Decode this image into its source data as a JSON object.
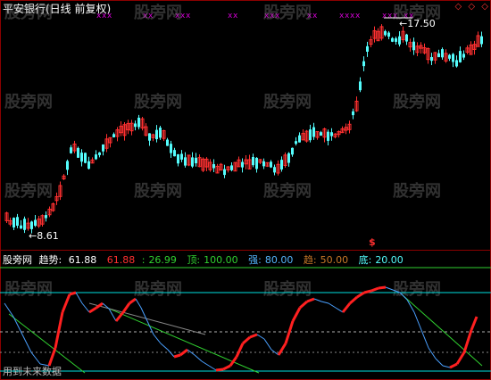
{
  "window": {
    "title": "平安银行(日线 前复权)"
  },
  "markers": {
    "x_symbol": "x",
    "diamond_symbol": "◇"
  },
  "price": {
    "high_label": "17.50",
    "low_label": "8.61",
    "low_arrow": "←",
    "high_arrow": "←"
  },
  "signal": {
    "dollar_label": "$"
  },
  "indicator": {
    "name": "股旁网",
    "trend_label": "趋势:",
    "trend_value": "61.88",
    "value2": "61.88",
    "value3_prefix": ":",
    "value3": "26.99",
    "top_label": "顶:",
    "top_value": "100.00",
    "strong_label": "强:",
    "strong_value": "80.00",
    "trend2_label": "趋:",
    "trend2_value": "50.00",
    "bottom_label": "底:",
    "bottom_value": "20.00"
  },
  "colors": {
    "up_candle": "#ff3030",
    "down_candle": "#54fcfc",
    "x_marker": "#d000d0",
    "top_line": "#00e0e0",
    "strong_line": "#30d030",
    "trend_line_up": "#ff2020",
    "trend_line_down": "#4aa0ff",
    "diag_line": "#30d030",
    "border": "#8b0000"
  },
  "watermarks": [
    "股旁网",
    "股旁网",
    "股旁网",
    "股旁网",
    "股旁网",
    "股旁网",
    "股旁网",
    "股旁网",
    "股旁网",
    "股旁网",
    "股旁网",
    "股旁网",
    "股旁网",
    "股旁网",
    "股旁网",
    "股旁网"
  ],
  "footer": {
    "text": "用到未来数据"
  }
}
